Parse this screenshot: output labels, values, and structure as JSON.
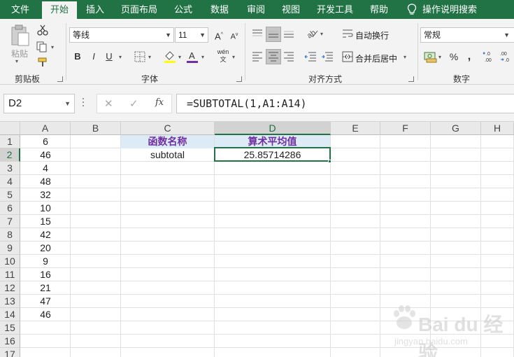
{
  "tabs": [
    {
      "label": "文件",
      "active": false
    },
    {
      "label": "开始",
      "active": true
    },
    {
      "label": "插入",
      "active": false
    },
    {
      "label": "页面布局",
      "active": false
    },
    {
      "label": "公式",
      "active": false
    },
    {
      "label": "数据",
      "active": false
    },
    {
      "label": "审阅",
      "active": false
    },
    {
      "label": "视图",
      "active": false
    },
    {
      "label": "开发工具",
      "active": false
    },
    {
      "label": "帮助",
      "active": false
    }
  ],
  "tell_me": "操作说明搜索",
  "ribbon": {
    "clipboard": {
      "paste_label": "粘贴",
      "group_label": "剪贴板"
    },
    "font": {
      "font_name": "等线",
      "font_size": "11",
      "bold": "B",
      "italic": "I",
      "underline": "U",
      "group_label": "字体",
      "grow": "A",
      "shrink": "A",
      "phonetic": "wén"
    },
    "alignment": {
      "wrap_text": "自动换行",
      "merge_center": "合并后居中",
      "group_label": "对齐方式"
    },
    "number": {
      "format": "常规",
      "percent": "%",
      "comma": ",",
      "inc_decimal": ".0 .00",
      "dec_decimal": ".00 →.0",
      "group_label": "数字"
    }
  },
  "formula_bar": {
    "name_box": "D2",
    "cancel": "✕",
    "enter": "✓",
    "fx": "fx",
    "formula": "=SUBTOTAL(1,A1:A14)"
  },
  "grid": {
    "columns": [
      "A",
      "B",
      "C",
      "D",
      "E",
      "F",
      "G",
      "H"
    ],
    "rows": [
      "1",
      "2",
      "3",
      "4",
      "5",
      "6",
      "7",
      "8",
      "9",
      "10",
      "11",
      "12",
      "13",
      "14",
      "15",
      "16",
      "17"
    ],
    "active_cell": "D2",
    "col_a_values": [
      "6",
      "46",
      "4",
      "48",
      "32",
      "10",
      "15",
      "42",
      "20",
      "9",
      "16",
      "21",
      "47",
      "46"
    ],
    "c1": "函数名称",
    "d1": "算术平均值",
    "c2": "subtotal",
    "d2": "25.85714286",
    "header_fill": "#ddebf7",
    "header_text_color": "#7030a0"
  },
  "accent": "#217346",
  "watermark": {
    "brand": "Bai du 经验",
    "sub": "jingyan.baidu.com"
  }
}
